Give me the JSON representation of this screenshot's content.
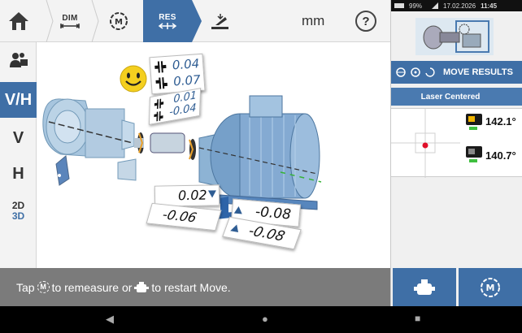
{
  "toolbar": {
    "dim_label": "DIM",
    "res_label": "RES",
    "unit": "mm",
    "help": "?",
    "icons": [
      "home-icon",
      "dim-icon",
      "measure-icon",
      "results-icon",
      "soft-foot-icon",
      "help-icon"
    ]
  },
  "sidebar": {
    "vh": "V/H",
    "v": "V",
    "h": "H",
    "mode_2d": "2D",
    "mode_3d": "3D"
  },
  "results": {
    "vertical_angle": "0.04",
    "vertical_offset": "0.07",
    "horizontal_angle": "0.01",
    "horizontal_offset": "-0.04",
    "front_foot_vertical": "0.02",
    "front_foot_horizontal": "-0.06",
    "back_foot_vertical": "-0.08",
    "back_foot_horizontal": "-0.08",
    "tolerance_status": "smiley-good"
  },
  "status": {
    "prefix": "Tap",
    "middle": "to remeasure or",
    "suffix": "to restart Move.",
    "m_glyph": "M"
  },
  "right_panel": {
    "battery": "99%",
    "date": "17.02.2026",
    "time": "11:45",
    "move_title": "MOVE RESULTS",
    "laser_status": "Laser Centered",
    "sensor1_value": "142.1°",
    "sensor2_value": "140.7°",
    "colors": {
      "accent": "#3f6fa6",
      "laser_dot": "#e0102a",
      "battery_good": "#3fbf3f"
    }
  },
  "nav": {
    "back": "◀",
    "home": "●",
    "recent": "■"
  }
}
